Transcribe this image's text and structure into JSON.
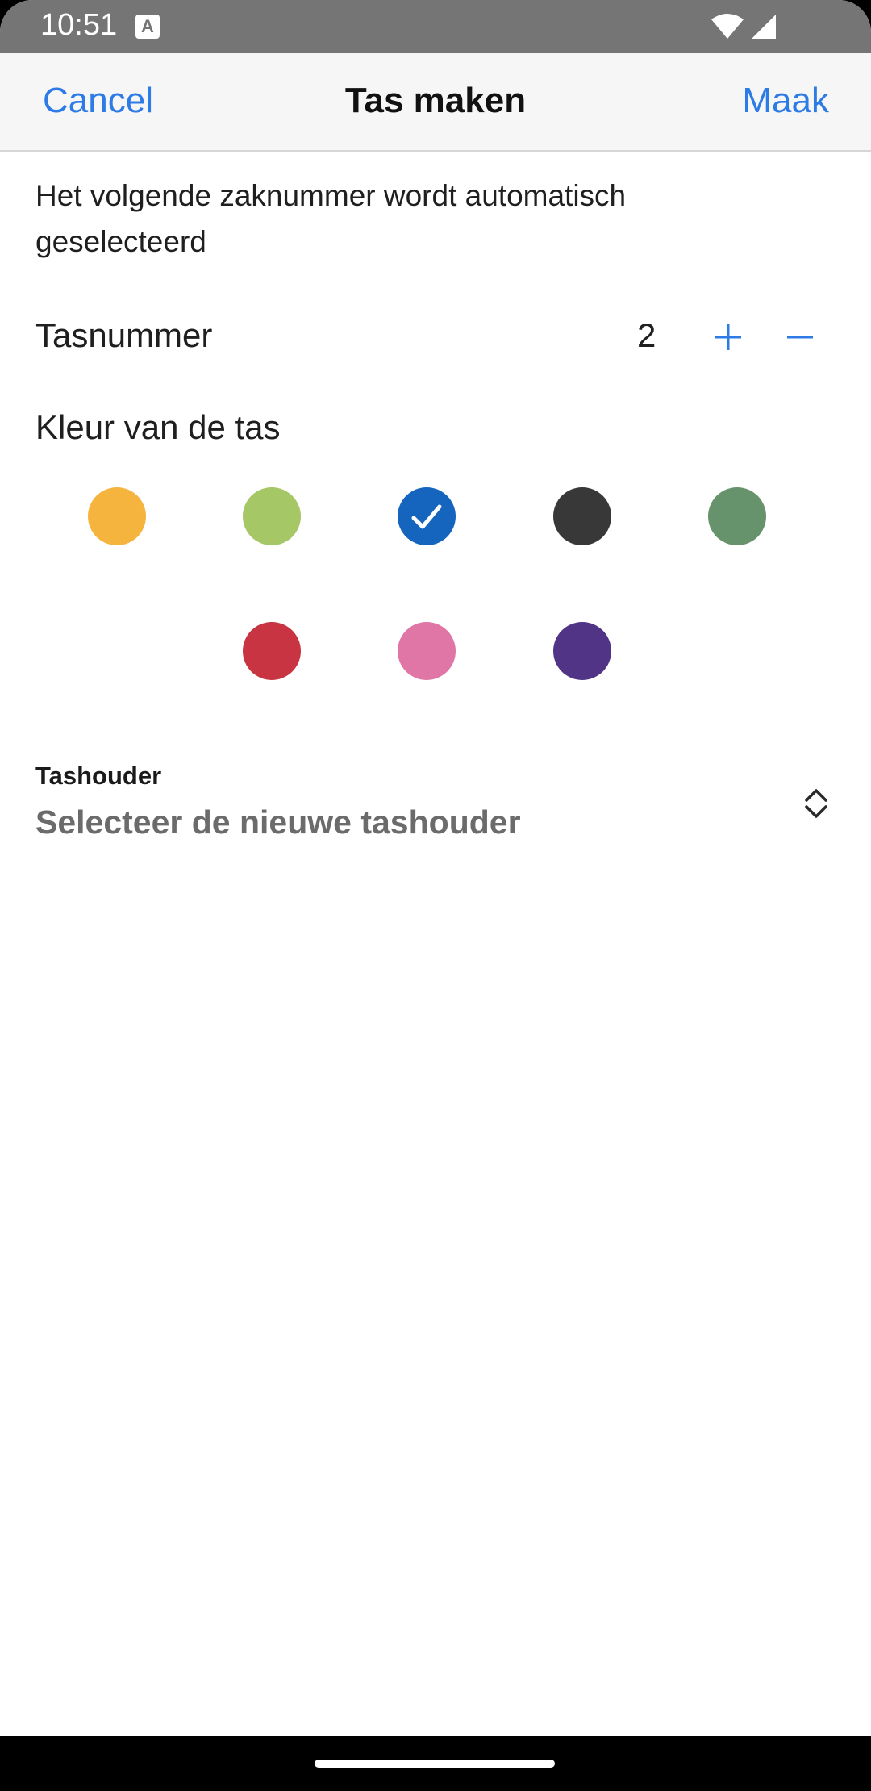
{
  "status_bar": {
    "time": "10:51",
    "notification_glyph": "A",
    "icons": [
      "wifi-icon",
      "signal-icon"
    ]
  },
  "nav": {
    "cancel_label": "Cancel",
    "title": "Tas maken",
    "make_label": "Maak"
  },
  "info_text": "Het volgende zaknummer wordt automatisch geselecteerd",
  "bag_number": {
    "label": "Tasnummer",
    "value": "2",
    "increment_icon": "plus-icon",
    "decrement_icon": "minus-icon"
  },
  "bag_color": {
    "label": "Kleur van de tas",
    "selected_index": 2,
    "colors": [
      "#F4B43D",
      "#A6C766",
      "#1565BF",
      "#383838",
      "#66936B",
      "#C83441",
      "#DF76A6",
      "#523487"
    ]
  },
  "bag_holder": {
    "label": "Tashouder",
    "placeholder": "Selecteer de nieuwe tashouder",
    "icon": "chevron-up-down-icon"
  },
  "accent_color": "#2D7BE5"
}
